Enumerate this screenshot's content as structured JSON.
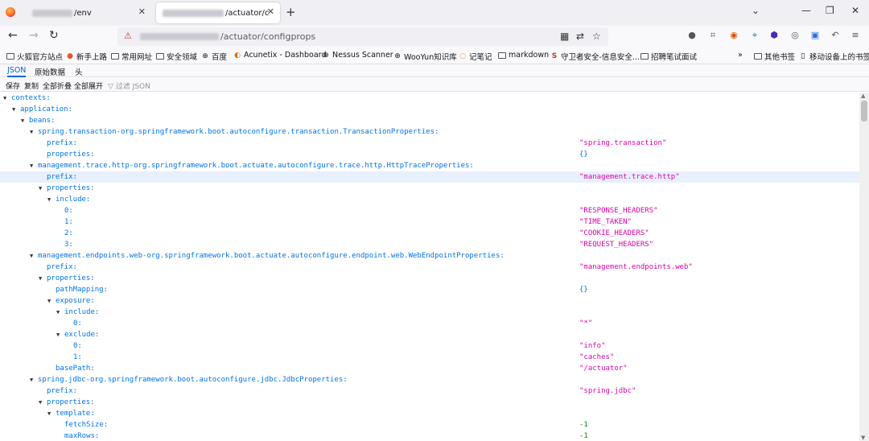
{
  "tabs": [
    {
      "title": "/env",
      "active": false
    },
    {
      "title": "/actuator/c",
      "active": true
    }
  ],
  "address_bar": {
    "url_visible": "/actuator/configprops"
  },
  "bookmarks": [
    {
      "label": "火狐官方站点",
      "icon": "firefox-icon"
    },
    {
      "label": "新手上路",
      "icon": "firefox-icon"
    },
    {
      "label": "常用网址",
      "icon": "folder-icon"
    },
    {
      "label": "安全领域",
      "icon": "folder-icon"
    },
    {
      "label": "百度",
      "icon": "globe-icon"
    },
    {
      "label": "Acunetix - Dashboard",
      "icon": "acunetix-icon"
    },
    {
      "label": "Nessus Scanner",
      "icon": "globe-icon"
    },
    {
      "label": "WooYun知识库",
      "icon": "globe-icon"
    },
    {
      "label": "记笔记",
      "icon": "note-icon"
    },
    {
      "label": "markdown",
      "icon": "folder-icon"
    },
    {
      "label": "守卫者安全-信息安全...",
      "icon": "s-icon"
    },
    {
      "label": "招聘笔试面试",
      "icon": "folder-icon"
    },
    {
      "label": "其他书签",
      "icon": "folder-icon"
    },
    {
      "label": "移动设备上的书签",
      "icon": "mobile-icon"
    }
  ],
  "viewer_tabs": [
    {
      "label": "JSON",
      "active": true
    },
    {
      "label": "原始数据",
      "active": false
    },
    {
      "label": "头",
      "active": false
    }
  ],
  "toolbar": {
    "save": "保存",
    "copy": "复制",
    "collapse_all": "全部折叠",
    "expand_all": "全部展开",
    "filter_placeholder": "过滤 JSON"
  },
  "json_rows": [
    {
      "key": "contexts:",
      "value": "",
      "vtype": "",
      "expanded": true
    },
    {
      "key": "application:",
      "value": "",
      "vtype": "",
      "expanded": true
    },
    {
      "key": "beans:",
      "value": "",
      "vtype": "",
      "expanded": true
    },
    {
      "key": "spring.transaction-org.springframework.boot.autoconfigure.transaction.TransactionProperties:",
      "value": "",
      "vtype": "",
      "expanded": true
    },
    {
      "key": "prefix:",
      "value": "\"spring.transaction\"",
      "vtype": "str"
    },
    {
      "key": "properties:",
      "value": "{}",
      "vtype": "obj"
    },
    {
      "key": "management.trace.http-org.springframework.boot.actuate.autoconfigure.trace.http.HttpTraceProperties:",
      "value": "",
      "vtype": "",
      "expanded": true
    },
    {
      "key": "prefix:",
      "value": "\"management.trace.http\"",
      "vtype": "str",
      "highlight": true
    },
    {
      "key": "properties:",
      "value": "",
      "vtype": "",
      "expanded": true
    },
    {
      "key": "include:",
      "value": "",
      "vtype": "",
      "expanded": true
    },
    {
      "key": "0:",
      "value": "\"RESPONSE_HEADERS\"",
      "vtype": "str"
    },
    {
      "key": "1:",
      "value": "\"TIME_TAKEN\"",
      "vtype": "str"
    },
    {
      "key": "2:",
      "value": "\"COOKIE_HEADERS\"",
      "vtype": "str"
    },
    {
      "key": "3:",
      "value": "\"REQUEST_HEADERS\"",
      "vtype": "str"
    },
    {
      "key": "management.endpoints.web-org.springframework.boot.actuate.autoconfigure.endpoint.web.WebEndpointProperties:",
      "value": "",
      "vtype": "",
      "expanded": true
    },
    {
      "key": "prefix:",
      "value": "\"management.endpoints.web\"",
      "vtype": "str"
    },
    {
      "key": "properties:",
      "value": "",
      "vtype": "",
      "expanded": true
    },
    {
      "key": "pathMapping:",
      "value": "{}",
      "vtype": "obj"
    },
    {
      "key": "exposure:",
      "value": "",
      "vtype": "",
      "expanded": true
    },
    {
      "key": "include:",
      "value": "",
      "vtype": "",
      "expanded": true
    },
    {
      "key": "0:",
      "value": "\"*\"",
      "vtype": "str"
    },
    {
      "key": "exclude:",
      "value": "",
      "vtype": "",
      "expanded": true
    },
    {
      "key": "0:",
      "value": "\"info\"",
      "vtype": "str"
    },
    {
      "key": "1:",
      "value": "\"caches\"",
      "vtype": "str"
    },
    {
      "key": "basePath:",
      "value": "\"/actuator\"",
      "vtype": "str"
    },
    {
      "key": "spring.jdbc-org.springframework.boot.autoconfigure.jdbc.JdbcProperties:",
      "value": "",
      "vtype": "",
      "expanded": true
    },
    {
      "key": "prefix:",
      "value": "\"spring.jdbc\"",
      "vtype": "str"
    },
    {
      "key": "properties:",
      "value": "",
      "vtype": "",
      "expanded": true
    },
    {
      "key": "template:",
      "value": "",
      "vtype": "",
      "expanded": true
    },
    {
      "key": "fetchSize:",
      "value": "-1",
      "vtype": "num"
    },
    {
      "key": "maxRows:",
      "value": "-1",
      "vtype": "num"
    }
  ],
  "colors": {
    "key": "#0074e8",
    "string": "#dd00a9",
    "number": "#058b00",
    "accent": "#0060df"
  }
}
